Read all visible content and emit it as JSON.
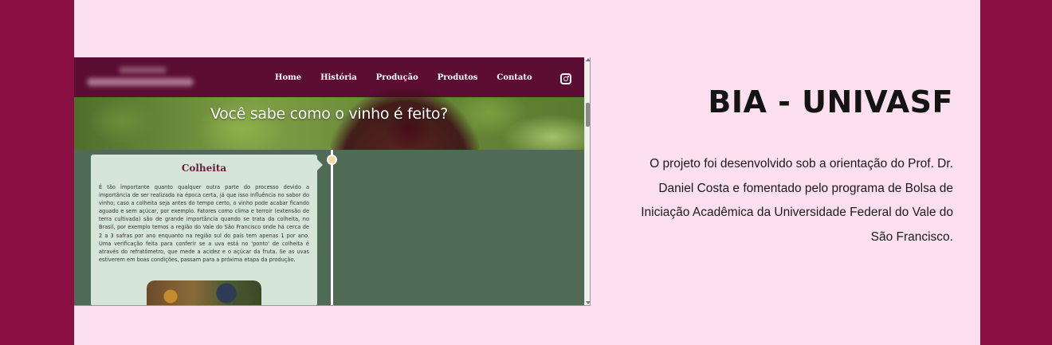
{
  "embedded_site": {
    "nav": {
      "items": [
        {
          "label": "Home"
        },
        {
          "label": "História"
        },
        {
          "label": "Produção"
        },
        {
          "label": "Produtos"
        },
        {
          "label": "Contato"
        }
      ],
      "social_icon": "instagram-icon"
    },
    "hero": {
      "title": "Você sabe como o vinho é feito?"
    },
    "timeline_card": {
      "title": "Colheita",
      "text": "É tão importante quanto qualquer outra parte do processo devido a importância de ser realizada na época certa, já que isso influência no sabor do vinho; caso a colheita seja antes do tempo certo, o vinho pode acabar ficando aguado e sem açúcar, por exemplo. Fatores como clima e terroir (extensão de terra cultivada) são de grande importância quando se trata da colheita, no Brasil, por exemplo temos a região do Vale do São Francisco onde há cerca de 2 a 3 safras por ano enquanto na região sul do país tem apenas 1 por ano. Uma verificação feita para conferir se a uva está no 'ponto' de colheita é através do refratômetro, que mede a acidez e o açúcar da fruta. Se as uvas estiverem em boas condições, passam para a próxima etapa da produção."
    }
  },
  "project": {
    "title": "BIA - UNIVASF",
    "description": "O projeto foi desenvolvido sob a orientação do Prof. Dr. Daniel Costa e fomentado pelo programa de Bolsa de Iniciação Acadêmica da Universidade Federal do Vale do São Francisco."
  },
  "colors": {
    "outer_background": "#8a0f42",
    "page_background": "#fde0ef",
    "site_nav": "#5b0d33",
    "site_content": "#506b55",
    "card_background": "#d5e5d7",
    "card_title": "#6b1a3a"
  }
}
